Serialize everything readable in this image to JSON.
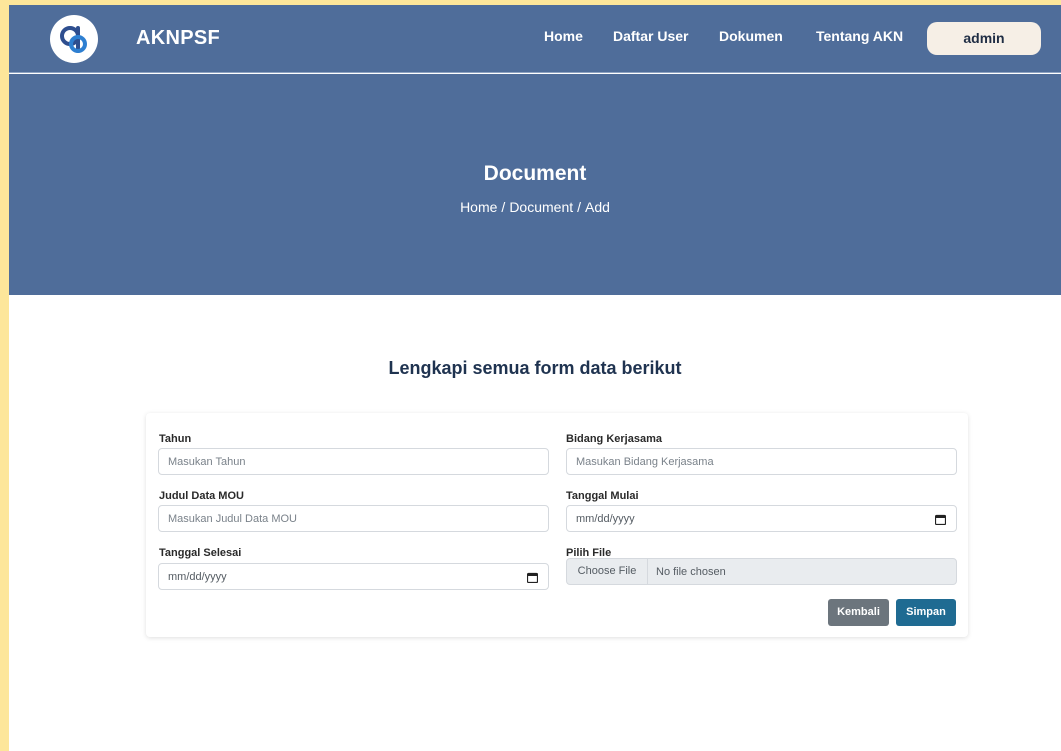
{
  "navbar": {
    "brand": "AKNPSF",
    "links": [
      "Home",
      "Daftar User",
      "Dokumen",
      "Tentang AKN"
    ],
    "user_button": "admin",
    "bg_color": "#4f6d9a"
  },
  "hero": {
    "title": "Document",
    "breadcrumb": [
      "Home",
      "Document",
      "Add"
    ],
    "separator": "/"
  },
  "form": {
    "heading": "Lengkapi semua form data berikut",
    "fields": {
      "tahun": {
        "label": "Tahun",
        "placeholder": "Masukan Tahun"
      },
      "bidang": {
        "label": "Bidang Kerjasama",
        "placeholder": "Masukan Bidang Kerjasama"
      },
      "judul": {
        "label": "Judul Data MOU",
        "placeholder": "Masukan Judul Data MOU"
      },
      "mulai": {
        "label": "Tanggal Mulai",
        "value": "mm/dd/yyyy"
      },
      "selesai": {
        "label": "Tanggal Selesai",
        "value": "mm/dd/yyyy"
      },
      "file": {
        "label": "Pilih File",
        "button": "Choose File",
        "status": "No file chosen"
      }
    },
    "buttons": {
      "back": "Kembali",
      "save": "Simpan"
    }
  }
}
